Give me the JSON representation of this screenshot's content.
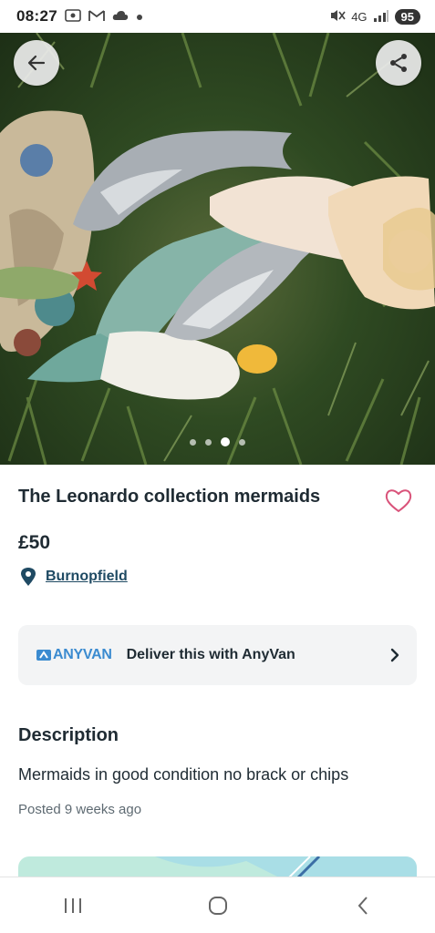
{
  "status_bar": {
    "time": "08:27",
    "network": "4G",
    "battery": "95",
    "icons": [
      "screen-record-icon",
      "gmail-icon",
      "cloud-icon",
      "dot-icon",
      "mute-icon",
      "signal-icon"
    ]
  },
  "hero": {
    "image_subject": "mermaid and dolphin figurine on grass",
    "carousel_total": 4,
    "carousel_active_index": 2
  },
  "listing": {
    "title": "The Leonardo collection mermaids",
    "price": "£50",
    "location": "Burnopfield"
  },
  "delivery": {
    "logo_text": "ANYVAN",
    "label": "Deliver this with AnyVan"
  },
  "description": {
    "heading": "Description",
    "body": "Mermaids in good condition no brack or chips",
    "posted": "Posted 9 weeks ago"
  },
  "colors": {
    "text_primary": "#1f2b33",
    "link": "#1f4a63",
    "favorite": "#d9537a",
    "anyvan_blue": "#3b8bd0",
    "map_teal": "#bfeadd"
  }
}
